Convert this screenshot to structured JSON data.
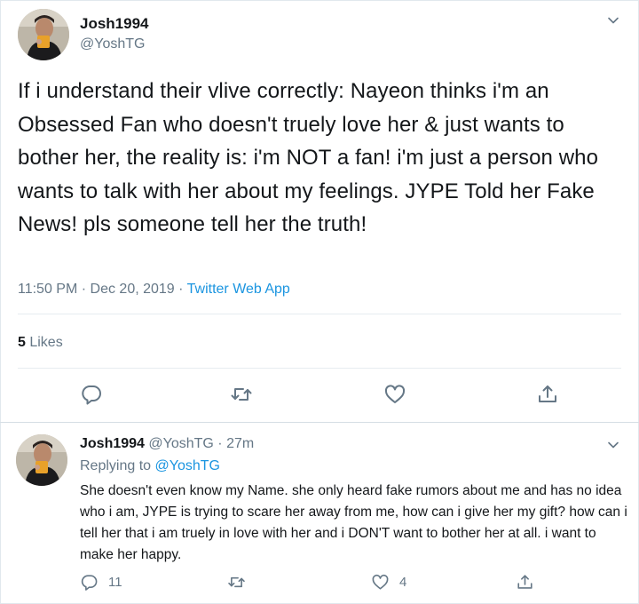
{
  "main_tweet": {
    "display_name": "Josh1994",
    "handle": "@YoshTG",
    "text": "If i understand their vlive correctly: Nayeon thinks i'm an Obsessed Fan who doesn't truely love her & just wants to bother her, the reality is: i'm NOT a fan! i'm just a person who wants to talk with her about my feelings. JYPE Told her Fake News! pls someone tell her the truth!",
    "timestamp": "11:50 PM · Dec 20, 2019 · ",
    "source": "Twitter Web App",
    "likes_count": "5",
    "likes_label": " Likes",
    "actions": [
      "reply-icon",
      "retweet-icon",
      "like-icon",
      "share-icon"
    ]
  },
  "reply_tweet": {
    "display_name": "Josh1994",
    "handle_time": " @YoshTG · 27m",
    "replying_label": "Replying to ",
    "replying_to": "@YoshTG",
    "text": "She doesn't even know my Name. she only heard fake rumors about me and has no idea who i am, JYPE is trying to scare her away from me, how can i give her my gift? how can i tell her that i am truely in love with her and i DON'T want to bother her at all. i want to make her happy.",
    "reply_count": "11",
    "like_count": "4"
  },
  "colors": {
    "text": "#14171a",
    "secondary": "#657786",
    "link": "#1b95e0",
    "divider": "#e6ecf0"
  }
}
